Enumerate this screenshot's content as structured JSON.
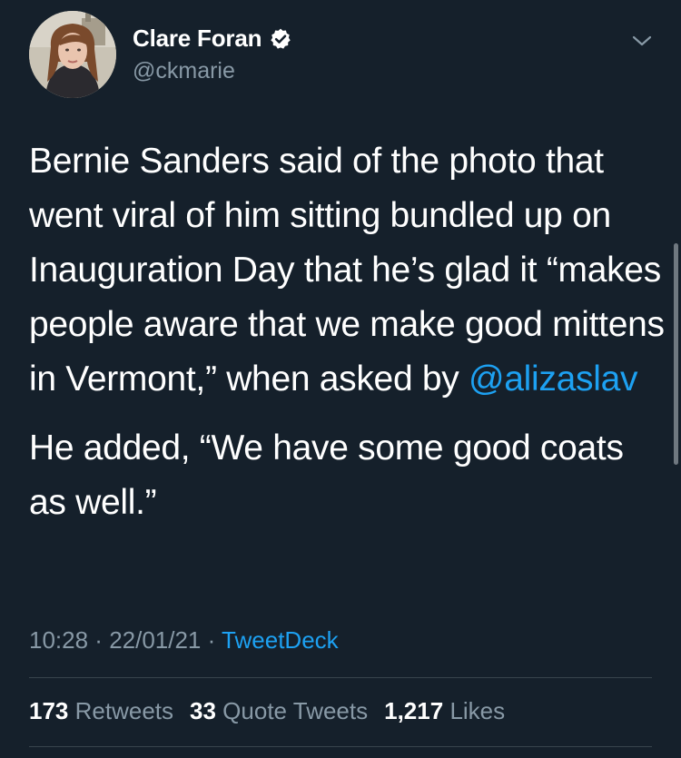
{
  "author": {
    "display_name": "Clare Foran",
    "handle": "@ckmarie",
    "verified": true,
    "avatar_icon": "profile-photo"
  },
  "tweet": {
    "paragraph1_text": "Bernie Sanders said of the photo that went viral of him sitting bundled up on Inauguration Day that he’s glad it “makes people aware that we make good mittens in Vermont,” when asked by ",
    "paragraph1_mention": "@alizaslav",
    "paragraph2_text": "He added, “We have some good coats as well.”"
  },
  "meta": {
    "time": "10:28",
    "separator1": " · ",
    "date": "22/01/21",
    "separator2": " · ",
    "source": "TweetDeck"
  },
  "stats": {
    "retweets_count": "173",
    "retweets_label": "Retweets",
    "quotes_count": "33",
    "quotes_label": "Quote Tweets",
    "likes_count": "1,217",
    "likes_label": "Likes"
  },
  "colors": {
    "background": "#15202b",
    "text": "#ffffff",
    "secondary": "#8899a6",
    "accent": "#1da1f2",
    "divider": "#38444d"
  }
}
